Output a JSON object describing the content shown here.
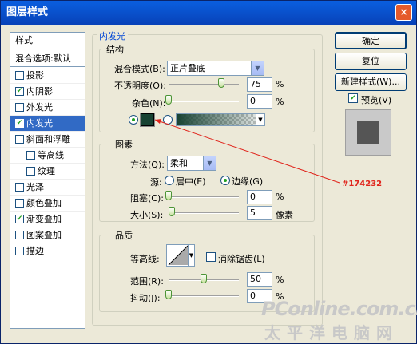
{
  "window": {
    "title": "图层样式",
    "close_glyph": "×"
  },
  "styles_panel": {
    "header": "样式",
    "blend_default": "混合选项:默认",
    "items": [
      {
        "label": "投影",
        "checked": false
      },
      {
        "label": "内阴影",
        "checked": true
      },
      {
        "label": "外发光",
        "checked": false
      },
      {
        "label": "内发光",
        "checked": true,
        "selected": true
      },
      {
        "label": "斜面和浮雕",
        "checked": false
      },
      {
        "label": "等高线",
        "checked": false
      },
      {
        "label": "纹理",
        "checked": false
      },
      {
        "label": "光泽",
        "checked": false
      },
      {
        "label": "颜色叠加",
        "checked": false
      },
      {
        "label": "渐变叠加",
        "checked": true
      },
      {
        "label": "图案叠加",
        "checked": false
      },
      {
        "label": "描边",
        "checked": false
      }
    ]
  },
  "inner_glow": {
    "title": "内发光",
    "structure": {
      "legend": "结构",
      "blend_mode_label": "混合模式(B):",
      "blend_mode_value": "正片叠底",
      "opacity_label": "不透明度(O):",
      "opacity_value": "75",
      "opacity_unit": "%",
      "opacity_level": 0.75,
      "noise_label": "杂色(N):",
      "noise_value": "0",
      "noise_unit": "%",
      "noise_level": 0,
      "color_swatch": "#174232",
      "gradient_selected": false
    },
    "elements": {
      "legend": "图素",
      "technique_label": "方法(Q):",
      "technique_value": "柔和",
      "source_label": "源:",
      "source_center": "居中(E)",
      "source_edge": "边缘(G)",
      "choke_label": "阻塞(C):",
      "choke_value": "0",
      "choke_unit": "%",
      "choke_level": 0,
      "size_label": "大小(S):",
      "size_value": "5",
      "size_unit": "像素"
    },
    "quality": {
      "legend": "品质",
      "contour_label": "等高线:",
      "antialias_label": "消除锯齿(L)",
      "range_label": "范围(R):",
      "range_value": "50",
      "range_unit": "%",
      "range_level": 0.5,
      "jitter_label": "抖动(J):",
      "jitter_value": "0",
      "jitter_unit": "%",
      "jitter_level": 0
    }
  },
  "buttons": {
    "ok": "确定",
    "reset": "复位",
    "new_style": "新建样式(W)...",
    "preview": "预览(V)",
    "preview_checked": true
  },
  "annotation": {
    "text": "#174232",
    "color": "#e0241b"
  },
  "watermark": {
    "line1": "PConline.com.cn",
    "line2": "太平洋电脑网"
  }
}
